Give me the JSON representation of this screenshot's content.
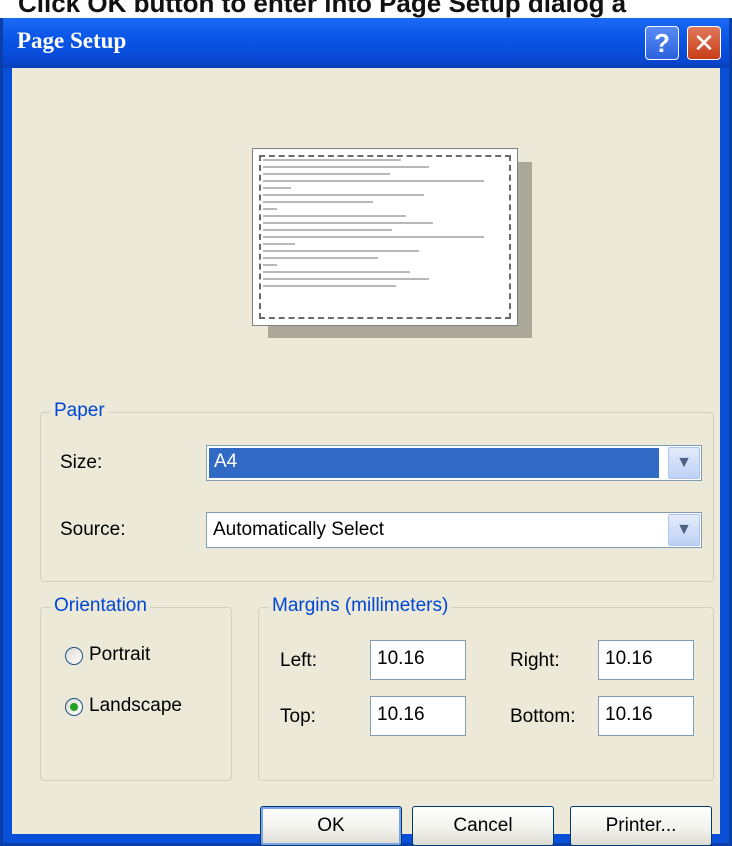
{
  "caption": "Click OK button to enter into Page Setup dialog a",
  "window": {
    "title": "Page Setup",
    "help_label": "?",
    "close_label": "✕"
  },
  "paper": {
    "group_label": "Paper",
    "size_label": "Size:",
    "size_value": "A4",
    "source_label": "Source:",
    "source_value": "Automatically Select"
  },
  "orientation": {
    "group_label": "Orientation",
    "portrait_label": "Portrait",
    "landscape_label": "Landscape",
    "selected": "landscape"
  },
  "margins": {
    "group_label": "Margins (millimeters)",
    "left_label": "Left:",
    "left_value": "10.16",
    "right_label": "Right:",
    "right_value": "10.16",
    "top_label": "Top:",
    "top_value": "10.16",
    "bottom_label": "Bottom:",
    "bottom_value": "10.16"
  },
  "buttons": {
    "ok": "OK",
    "cancel": "Cancel",
    "printer": "Printer..."
  },
  "colors": {
    "titlebar": "#0a56e8",
    "dialog_bg": "#ece9d8",
    "group_label": "#0046d5",
    "selection": "#316ac5"
  }
}
